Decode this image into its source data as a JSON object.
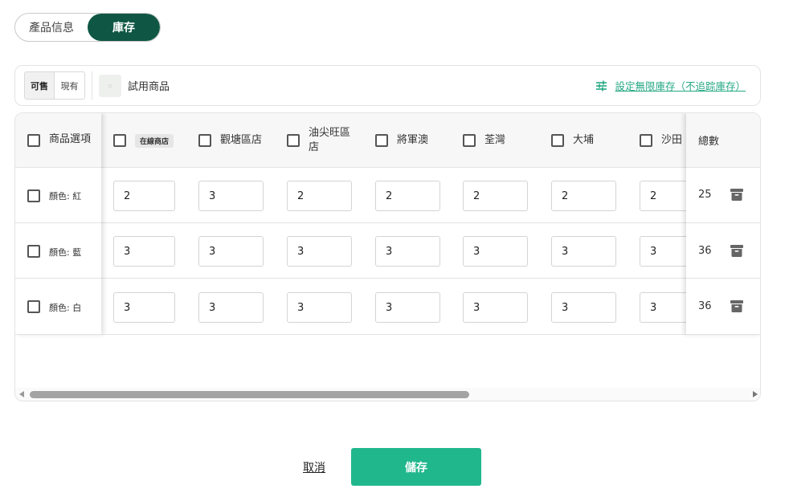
{
  "tabs": [
    {
      "label": "產品信息",
      "active": false
    },
    {
      "label": "庫存",
      "active": true
    }
  ],
  "toolbar": {
    "toggle": [
      {
        "label": "可售",
        "active": true
      },
      {
        "label": "現有",
        "active": false
      }
    ],
    "thumbnail_icon": "product-image-icon",
    "product_name": "試用商品",
    "unlimited_link": "設定無限庫存（不追踪庫存）",
    "unlimited_icon": "sliders-icon"
  },
  "table": {
    "first_col_header": "商品選項",
    "locations": [
      {
        "label": "在線商店",
        "badge": true
      },
      {
        "label": "觀塘區店",
        "badge": false
      },
      {
        "label": "油尖旺區店",
        "badge": false
      },
      {
        "label": "將軍澳",
        "badge": false
      },
      {
        "label": "荃灣",
        "badge": false
      },
      {
        "label": "大埔",
        "badge": false
      },
      {
        "label": "沙田",
        "badge": false
      }
    ],
    "total_header": "總數",
    "rows": [
      {
        "variant": "顏色: 紅",
        "quantities": [
          "2",
          "3",
          "2",
          "2",
          "2",
          "2",
          "2"
        ],
        "total": "25"
      },
      {
        "variant": "顏色: 藍",
        "quantities": [
          "3",
          "3",
          "3",
          "3",
          "3",
          "3",
          "3"
        ],
        "total": "36"
      },
      {
        "variant": "顏色: 白",
        "quantities": [
          "3",
          "3",
          "3",
          "3",
          "3",
          "3",
          "3"
        ],
        "total": "36"
      }
    ],
    "archive_icon": "archive-icon"
  },
  "footer": {
    "cancel_label": "取消",
    "save_label": "儲存"
  },
  "colors": {
    "primary_dark": "#0f5744",
    "primary": "#21b78c",
    "link": "#26a884"
  }
}
